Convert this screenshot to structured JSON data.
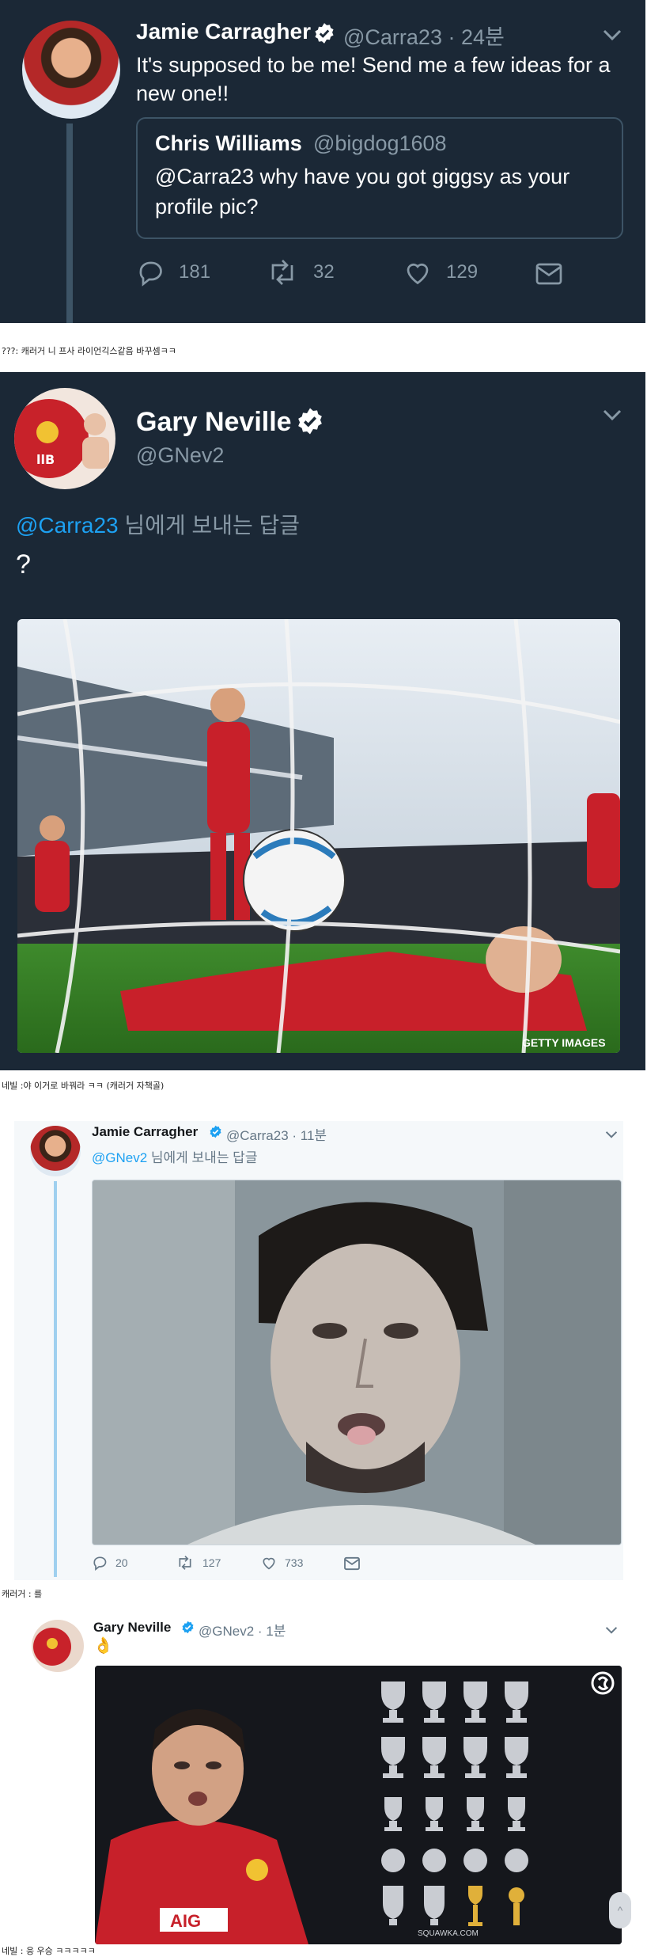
{
  "tweet1": {
    "name": "Jamie Carragher",
    "handle_time": "@Carra23 · 24분",
    "text": "It's supposed to be me! Send me a few ideas for a new one!!",
    "quote": {
      "name": "Chris Williams",
      "handle": "@bigdog1608",
      "text": "@Carra23 why have you got giggsy as your profile pic?"
    },
    "actions": {
      "replies": "181",
      "retweets": "32",
      "likes": "129"
    }
  },
  "caption1": "???: 캐러거 니 프사 라이언긱스같음 바꾸셈ㅋㅋ",
  "tweet2": {
    "name": "Gary Neville",
    "handle": "@GNev2",
    "reply_mention": "@Carra23",
    "reply_suffix": " 님에게 보내는 답글",
    "text": "?",
    "photo_credit": "GETTY IMAGES"
  },
  "caption2": "네빌 :야 이거로 바꿔라 ㅋㅋ (캐러거 자책골)",
  "tweet3": {
    "name": "Jamie Carragher",
    "handle_time": "@Carra23 · 11분",
    "reply_mention": "@GNev2",
    "reply_suffix": " 님에게 보내는 답글",
    "actions": {
      "replies": "20",
      "retweets": "127",
      "likes": "733"
    }
  },
  "caption3": "캐러거 : 를",
  "tweet4": {
    "name": "Gary Neville",
    "handle_time": "@GNev2 · 1분",
    "emoji": "👌",
    "image_logo": "SQUAWKA.COM",
    "image_shirt_text": "AIG",
    "scroll_top_icon": "^"
  },
  "caption4": "네빌 : 응 우승 ㅋㅋㅋㅋㅋ",
  "colors": {
    "dark_bg": "#1b2836",
    "muted": "#8899a6",
    "twitter_blue": "#1da1f2",
    "verified": "#ffffff",
    "verified_light": "#1da1f2"
  }
}
